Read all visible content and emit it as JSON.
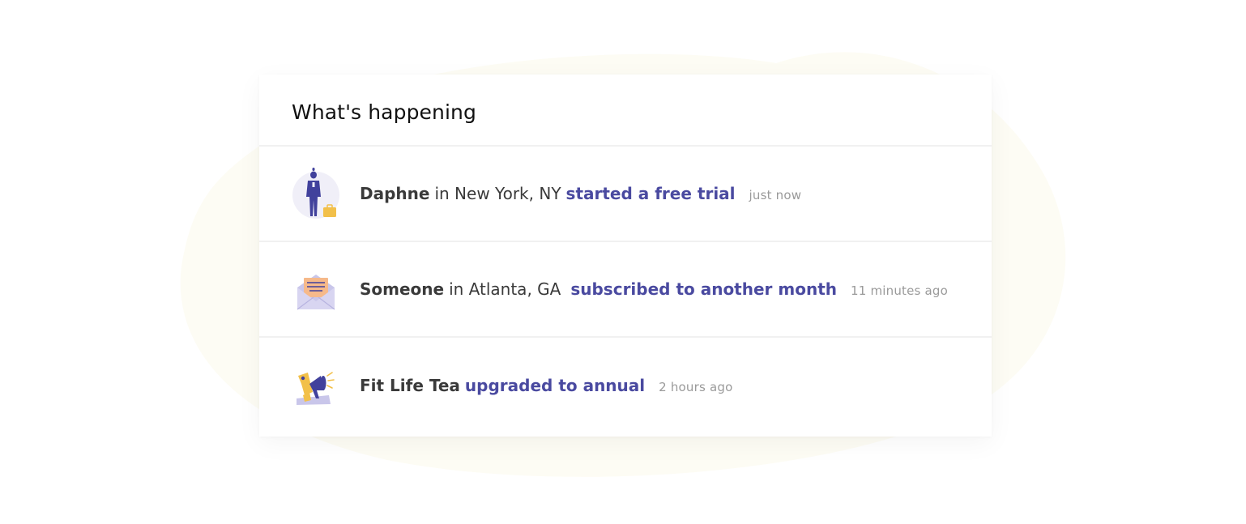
{
  "feed": {
    "title": "What's happening",
    "items": [
      {
        "icon": "person-with-briefcase-icon",
        "name": "Daphne",
        "location": "in New York, NY",
        "action": "started a free trial",
        "time": "just now"
      },
      {
        "icon": "envelope-letter-icon",
        "name": "Someone",
        "location": "in Atlanta, GA",
        "action": "subscribed to another month",
        "time": "11 minutes ago"
      },
      {
        "icon": "megaphone-icon",
        "name": "Fit Life Tea",
        "location": "",
        "action": "upgraded to annual",
        "time": "2 hours ago"
      }
    ]
  },
  "colors": {
    "accent": "#4a4aa0",
    "background_blob": "#fdfcf5",
    "icon_purple": "#41419c",
    "icon_yellow": "#f2c04a",
    "icon_lavender": "#c9c6ea"
  }
}
